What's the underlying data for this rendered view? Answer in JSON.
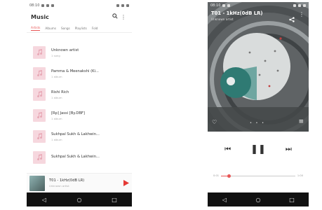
{
  "left": {
    "status_time": "08:10",
    "app_title": "Music",
    "tabs": [
      "Artists",
      "Albums",
      "Songs",
      "Playlists",
      "Fold"
    ],
    "artists": [
      {
        "name": "Unknown artist",
        "sub": "1 song"
      },
      {
        "name": "Pamma & Meenakshi (Ki...",
        "sub": "1 album"
      },
      {
        "name": "Rishi Rich",
        "sub": "1 album"
      },
      {
        "name": "[Rp] Jassi [By.DBF]",
        "sub": "1 album"
      },
      {
        "name": "Sukhpal Sukh & Lakhwin...",
        "sub": "1 album"
      },
      {
        "name": "Sukhpal Sukh & Lakhwin...",
        "sub": ""
      }
    ],
    "mini_player": {
      "title": "T01 - 1kHz(0dB LR)",
      "artist": "Unknown artist"
    },
    "accent": "#e85656"
  },
  "right": {
    "status_time": "08:10",
    "track_title": "T01 - 1kHz(0dB LR)",
    "track_artist": "Unknown artist",
    "time_elapsed": "0:01",
    "time_total": "1:00",
    "progress": 0.1
  },
  "icons": {
    "search": "search-icon",
    "more": "more-vert-icon",
    "share": "share-icon",
    "favorite": "heart-icon",
    "queue": "queue-icon",
    "prev": "skip-previous-icon",
    "pause": "pause-icon",
    "next": "skip-next-icon",
    "back": "nav-back-icon",
    "home": "nav-home-icon",
    "recents": "nav-recents-icon"
  }
}
